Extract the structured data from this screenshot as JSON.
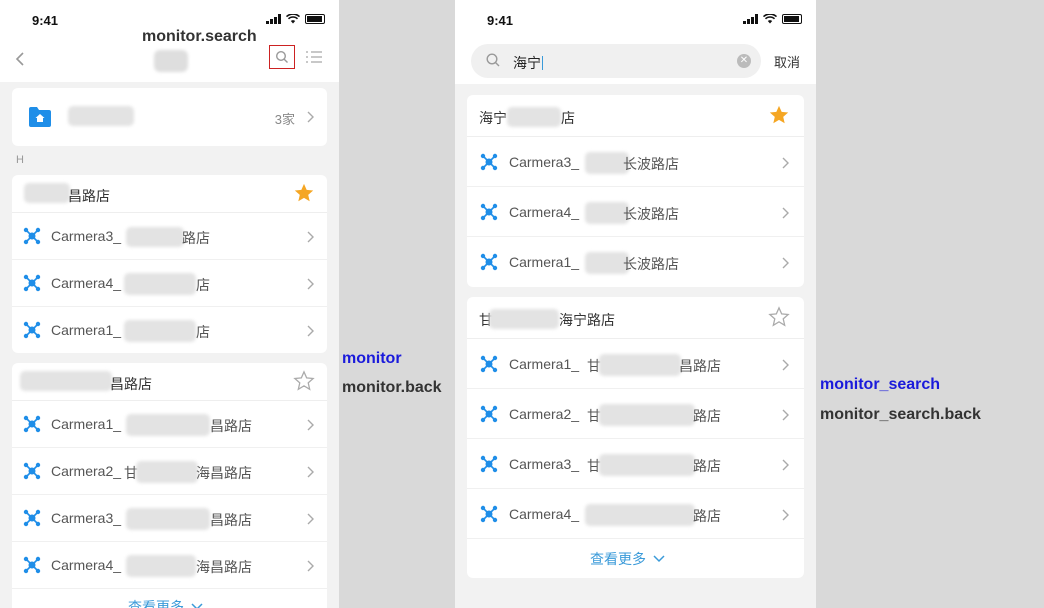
{
  "status": {
    "time": "9:41"
  },
  "annotations": {
    "search_label": "monitor.search",
    "left_screen": "monitor",
    "left_back": "monitor.back",
    "right_screen": "monitor_search",
    "right_back": "monitor_search.back"
  },
  "monitor": {
    "store_count": "3家",
    "group_letter": "H",
    "groups": [
      {
        "title": "昌路店",
        "favorite": true,
        "cameras": [
          {
            "name": "Carmera3_",
            "suffix": "路店"
          },
          {
            "name": "Carmera4_",
            "suffix": "店"
          },
          {
            "name": "Carmera1_",
            "suffix": "店"
          }
        ]
      },
      {
        "title": "昌路店",
        "favorite": false,
        "cameras": [
          {
            "name": "Carmera1_",
            "suffix": "昌路店"
          },
          {
            "name": "Carmera2_",
            "mid": "甘",
            "suffix": "海昌路店"
          },
          {
            "name": "Carmera3_",
            "suffix": "昌路店"
          },
          {
            "name": "Carmera4_",
            "suffix": "海昌路店"
          }
        ]
      }
    ],
    "more_label": "查看更多"
  },
  "monitor_search": {
    "query": "海宁",
    "cancel_label": "取消",
    "groups": [
      {
        "title_prefix": "海宁",
        "title_suffix": "店",
        "favorite": true,
        "cameras": [
          {
            "name": "Carmera3_",
            "suffix": "长波路店"
          },
          {
            "name": "Carmera4_",
            "suffix": "长波路店"
          },
          {
            "name": "Carmera1_",
            "suffix": "长波路店"
          }
        ]
      },
      {
        "title_prefix": "甘",
        "title_suffix": "海宁路店",
        "favorite": false,
        "cameras": [
          {
            "name": "Carmera1_",
            "mid": "甘",
            "suffix": "昌路店"
          },
          {
            "name": "Carmera2_",
            "mid": "甘",
            "suffix": "路店"
          },
          {
            "name": "Carmera3_",
            "mid": "甘",
            "suffix": "路店"
          },
          {
            "name": "Carmera4_",
            "suffix": "路店"
          }
        ]
      }
    ],
    "more_label": "查看更多"
  },
  "colors": {
    "accent": "#3a9ad9",
    "star": "#f5a623",
    "highlight_box": "#cc2222"
  },
  "icons": [
    "search-icon",
    "list-icon",
    "back-arrow-icon",
    "folder-home-icon",
    "camera-node-icon",
    "star-icon",
    "chevron-right-icon",
    "chevron-down-icon",
    "clear-icon"
  ]
}
